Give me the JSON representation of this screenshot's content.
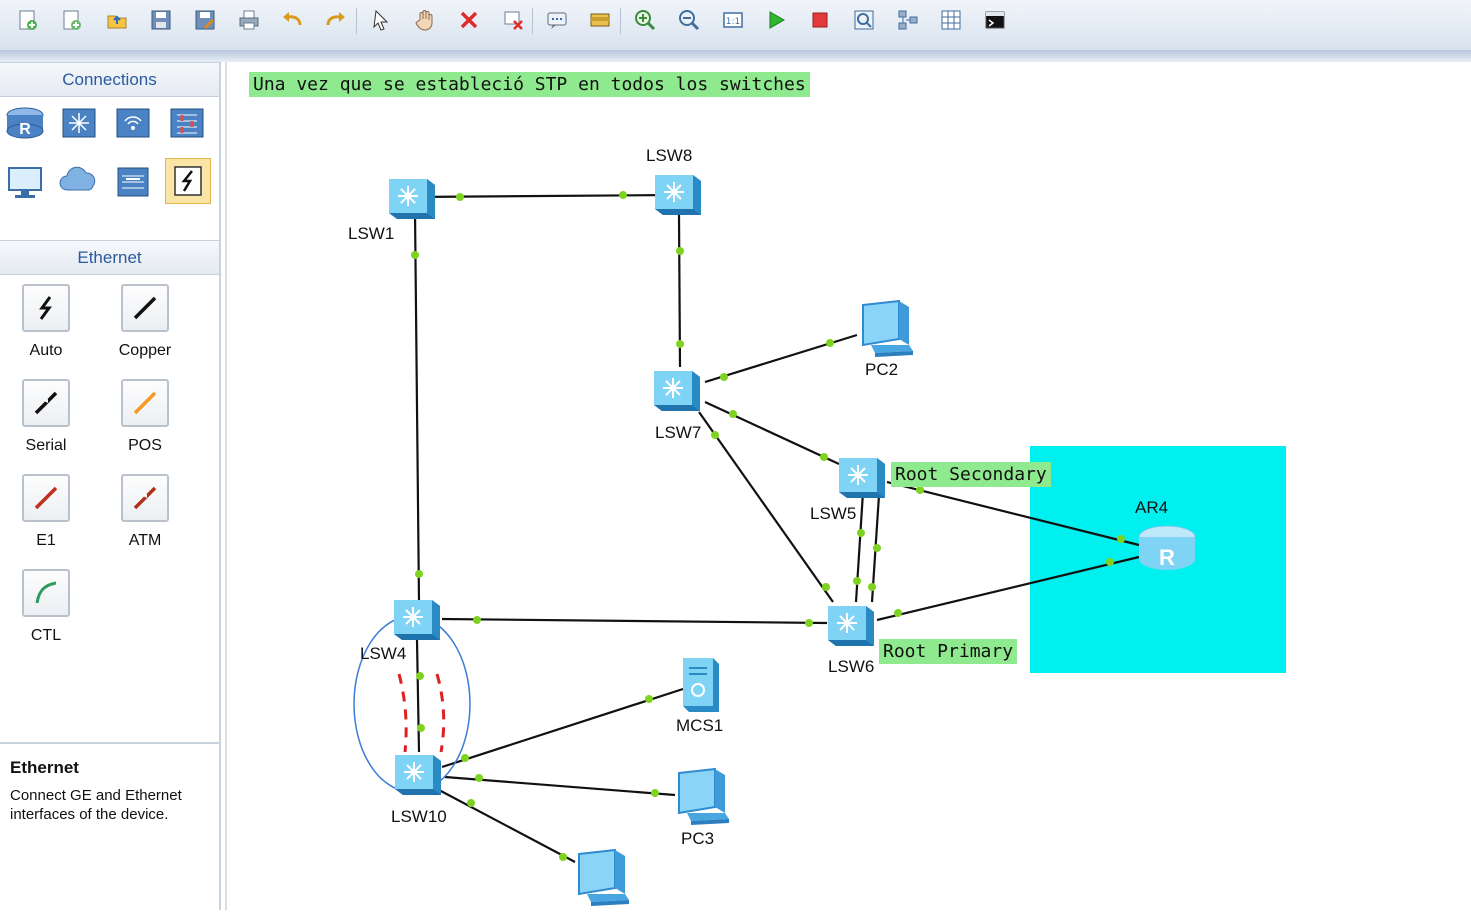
{
  "toolbar": {
    "buttons": [
      {
        "icon": "new-topology-icon"
      },
      {
        "icon": "new-page-icon"
      },
      {
        "icon": "open-icon"
      },
      {
        "icon": "save-icon"
      },
      {
        "icon": "save-as-icon"
      },
      {
        "icon": "print-icon"
      },
      {
        "icon": "undo-icon"
      },
      {
        "icon": "redo-icon"
      },
      {
        "icon": "select-pointer-icon"
      },
      {
        "icon": "pan-hand-icon"
      },
      {
        "icon": "delete-icon"
      },
      {
        "icon": "delete-link-icon"
      },
      {
        "icon": "text-note-icon"
      },
      {
        "icon": "palette-icon"
      },
      {
        "icon": "zoom-in-icon"
      },
      {
        "icon": "zoom-out-icon"
      },
      {
        "icon": "fit-view-icon"
      },
      {
        "icon": "start-devices-icon"
      },
      {
        "icon": "stop-devices-icon"
      },
      {
        "icon": "capture-icon"
      },
      {
        "icon": "topology-icon"
      },
      {
        "icon": "grid-icon"
      },
      {
        "icon": "cli-icon"
      }
    ]
  },
  "left_panel": {
    "connections_header": "Connections",
    "device_categories": [
      {
        "name": "router-icon"
      },
      {
        "name": "switch-icon"
      },
      {
        "name": "wireless-icon"
      },
      {
        "name": "firewall-icon"
      },
      {
        "name": "pc-icon"
      },
      {
        "name": "cloud-icon"
      },
      {
        "name": "server-icon"
      },
      {
        "name": "connection-cable-icon",
        "selected": true
      }
    ],
    "ethernet_header": "Ethernet",
    "cables": [
      {
        "label": "Auto"
      },
      {
        "label": "Copper"
      },
      {
        "label": "Serial"
      },
      {
        "label": "POS"
      },
      {
        "label": "E1"
      },
      {
        "label": "ATM"
      },
      {
        "label": "CTL"
      }
    ],
    "description": {
      "title": "Ethernet",
      "text": "Connect GE and Ethernet interfaces of the device."
    }
  },
  "workspace": {
    "title_note": "Una vez que se estableció STP en todos los switches",
    "notes": {
      "root_secondary": "Root Secondary",
      "root_primary": "Root Primary"
    },
    "devices": {
      "lsw1": "LSW1",
      "lsw8": "LSW8",
      "lsw7": "LSW7",
      "lsw5": "LSW5",
      "lsw6": "LSW6",
      "lsw4": "LSW4",
      "lsw10": "LSW10",
      "pc2": "PC2",
      "pc3": "PC3",
      "mcs1": "MCS1",
      "ar4": "AR4"
    },
    "colors": {
      "area": "#00f0f0",
      "note": "#8fe98f",
      "port": "#7ed321",
      "switch": "#5ec8ee",
      "blocked": "#e02020",
      "loop_ring": "#3a7bd5"
    }
  }
}
